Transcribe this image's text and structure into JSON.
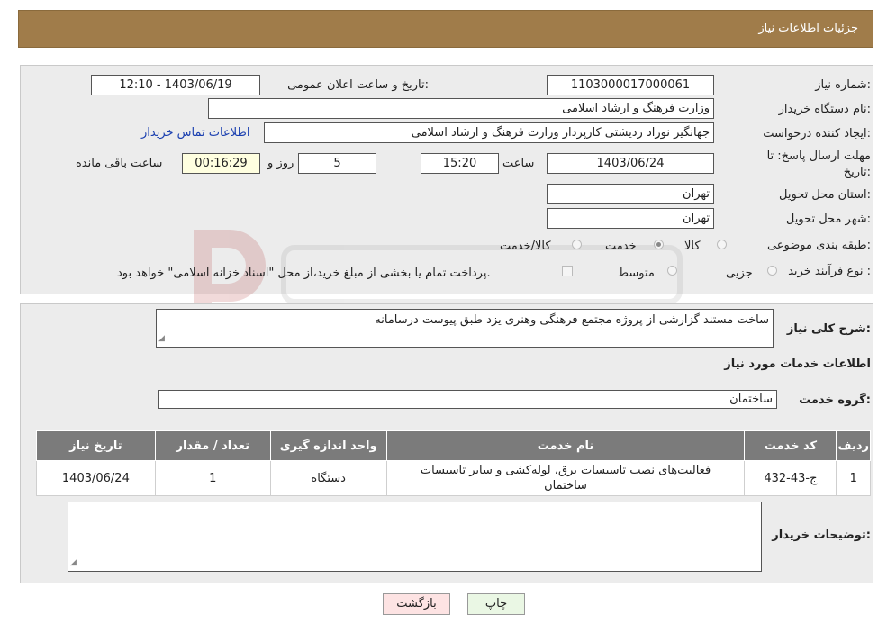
{
  "header": {
    "title": "جزئیات اطلاعات نیاز"
  },
  "form": {
    "need_number_label": "شماره نیاز:",
    "need_number": "1103000017000061",
    "announce_label": "تاریخ و ساعت اعلان عمومی:",
    "announce_value": "1403/06/19 - 12:10",
    "buyer_org_label": "نام دستگاه خریدار:",
    "buyer_org": "وزارت فرهنگ و ارشاد اسلامی",
    "creator_label": "ایجاد کننده درخواست:",
    "creator": "جهانگیر نوزاد ردیشتی کارپرداز وزارت فرهنگ و ارشاد اسلامی",
    "contact_link": "اطلاعات تماس خریدار",
    "deadline_label_1": "مهلت ارسال پاسخ: تا",
    "deadline_label_2": "تاریخ:",
    "deadline_date": "1403/06/24",
    "time_label": "ساعت",
    "deadline_time": "15:20",
    "days_value": "5",
    "days_label": "روز و",
    "remaining_time": "00:16:29",
    "remaining_label": "ساعت باقی مانده",
    "province_label": "استان محل تحویل:",
    "province": "تهران",
    "city_label": "شهر محل تحویل:",
    "city": "تهران",
    "category_label": "طبقه بندی موضوعی:",
    "category_options": [
      "کالا",
      "خدمت",
      "کالا/خدمت"
    ],
    "category_selected": "خدمت",
    "process_label": "نوع فرآیند خرید :",
    "process_options": [
      "جزیی",
      "متوسط"
    ],
    "payment_note": "پرداخت تمام یا بخشی از مبلغ خرید،از محل \"اسناد خزانه اسلامی\" خواهد بود."
  },
  "description": {
    "label": "شرح کلی نیاز:",
    "text": "ساخت مستند گزارشی از پروژه مجتمع  فرهنگی وهنری یزد طبق پیوست درسامانه"
  },
  "services": {
    "title": "اطلاعات خدمات مورد نیاز",
    "group_label": "گروه خدمت:",
    "group_value": "ساختمان",
    "columns": [
      "ردیف",
      "کد خدمت",
      "نام خدمت",
      "واحد اندازه گیری",
      "تعداد / مقدار",
      "تاریخ نیاز"
    ],
    "rows": [
      {
        "row": "1",
        "code": "ج-43-432",
        "name": "فعالیت‌های نصب تاسیسات برق، لوله‌کشی و سایر تاسیسات ساختمان",
        "unit": "دستگاه",
        "qty": "1",
        "date": "1403/06/24"
      }
    ]
  },
  "buyer_notes": {
    "label": "توضیحات خریدار:",
    "text": ""
  },
  "buttons": {
    "print": "چاپ",
    "back": "بازگشت"
  },
  "colors": {
    "header_bg": "#a07c4a",
    "table_header_bg": "#7b7b7b",
    "back_button_bg": "#fde3e3",
    "print_button_bg": "#eaf7e4",
    "link": "#1a3fb0"
  }
}
